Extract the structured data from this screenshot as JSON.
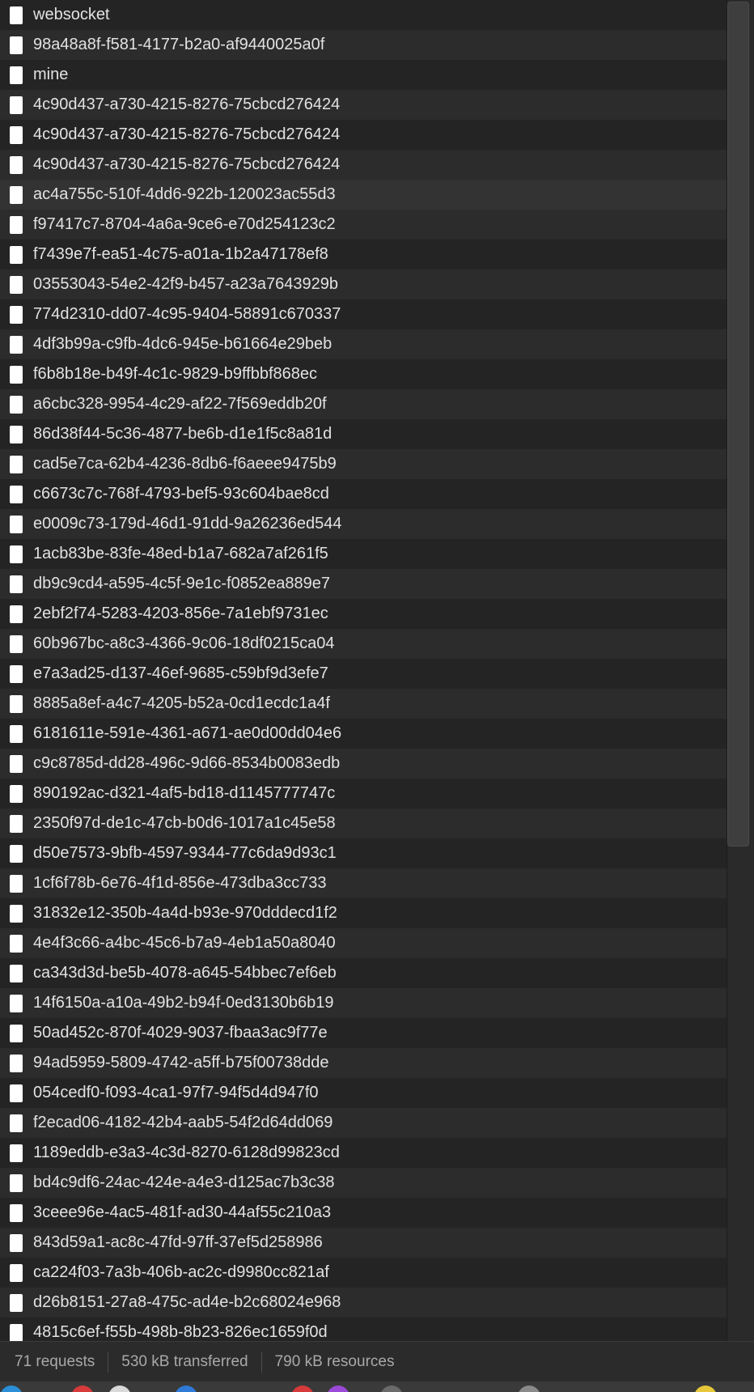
{
  "requests": [
    {
      "name": "websocket"
    },
    {
      "name": "98a48a8f-f581-4177-b2a0-af9440025a0f"
    },
    {
      "name": "mine"
    },
    {
      "name": "4c90d437-a730-4215-8276-75cbcd276424"
    },
    {
      "name": "4c90d437-a730-4215-8276-75cbcd276424"
    },
    {
      "name": "4c90d437-a730-4215-8276-75cbcd276424"
    },
    {
      "name": "ac4a755c-510f-4dd6-922b-120023ac55d3"
    },
    {
      "name": "f97417c7-8704-4a6a-9ce6-e70d254123c2"
    },
    {
      "name": "f7439e7f-ea51-4c75-a01a-1b2a47178ef8"
    },
    {
      "name": "03553043-54e2-42f9-b457-a23a7643929b"
    },
    {
      "name": "774d2310-dd07-4c95-9404-58891c670337"
    },
    {
      "name": "4df3b99a-c9fb-4dc6-945e-b61664e29beb"
    },
    {
      "name": "f6b8b18e-b49f-4c1c-9829-b9ffbbf868ec"
    },
    {
      "name": "a6cbc328-9954-4c29-af22-7f569eddb20f"
    },
    {
      "name": "86d38f44-5c36-4877-be6b-d1e1f5c8a81d"
    },
    {
      "name": "cad5e7ca-62b4-4236-8db6-f6aeee9475b9"
    },
    {
      "name": "c6673c7c-768f-4793-bef5-93c604bae8cd"
    },
    {
      "name": "e0009c73-179d-46d1-91dd-9a26236ed544"
    },
    {
      "name": "1acb83be-83fe-48ed-b1a7-682a7af261f5"
    },
    {
      "name": "db9c9cd4-a595-4c5f-9e1c-f0852ea889e7"
    },
    {
      "name": "2ebf2f74-5283-4203-856e-7a1ebf9731ec"
    },
    {
      "name": "60b967bc-a8c3-4366-9c06-18df0215ca04"
    },
    {
      "name": "e7a3ad25-d137-46ef-9685-c59bf9d3efe7"
    },
    {
      "name": "8885a8ef-a4c7-4205-b52a-0cd1ecdc1a4f"
    },
    {
      "name": "6181611e-591e-4361-a671-ae0d00dd04e6"
    },
    {
      "name": "c9c8785d-dd28-496c-9d66-8534b0083edb"
    },
    {
      "name": "890192ac-d321-4af5-bd18-d1145777747c"
    },
    {
      "name": "2350f97d-de1c-47cb-b0d6-1017a1c45e58"
    },
    {
      "name": "d50e7573-9bfb-4597-9344-77c6da9d93c1"
    },
    {
      "name": "1cf6f78b-6e76-4f1d-856e-473dba3cc733"
    },
    {
      "name": "31832e12-350b-4a4d-b93e-970dddecd1f2"
    },
    {
      "name": "4e4f3c66-a4bc-45c6-b7a9-4eb1a50a8040"
    },
    {
      "name": "ca343d3d-be5b-4078-a645-54bbec7ef6eb"
    },
    {
      "name": "14f6150a-a10a-49b2-b94f-0ed3130b6b19"
    },
    {
      "name": "50ad452c-870f-4029-9037-fbaa3ac9f77e"
    },
    {
      "name": "94ad5959-5809-4742-a5ff-b75f00738dde"
    },
    {
      "name": "054cedf0-f093-4ca1-97f7-94f5d4d947f0"
    },
    {
      "name": "f2ecad06-4182-42b4-aab5-54f2d64dd069"
    },
    {
      "name": "1189eddb-e3a3-4c3d-8270-6128d99823cd"
    },
    {
      "name": "bd4c9df6-24ac-424e-a4e3-d125ac7b3c38"
    },
    {
      "name": "3ceee96e-4ac5-481f-ad30-44af55c210a3"
    },
    {
      "name": "843d59a1-ac8c-47fd-97ff-37ef5d258986"
    },
    {
      "name": "ca224f03-7a3b-406b-ac2c-d9980cc821af"
    },
    {
      "name": "d26b8151-27a8-475c-ad4e-b2c68024e968"
    },
    {
      "name": "4815c6ef-f55b-498b-8b23-826ec1659f0d"
    }
  ],
  "selected_index": 6,
  "status": {
    "requests": "71 requests",
    "transferred": "530 kB transferred",
    "resources": "790 kB resources"
  },
  "icons": {
    "row_icon": "document-icon"
  },
  "colors": {
    "background": "#242424",
    "row_alt": "#2c2c2c",
    "text": "#e2e2e2",
    "status_text": "#a9a9a9"
  }
}
